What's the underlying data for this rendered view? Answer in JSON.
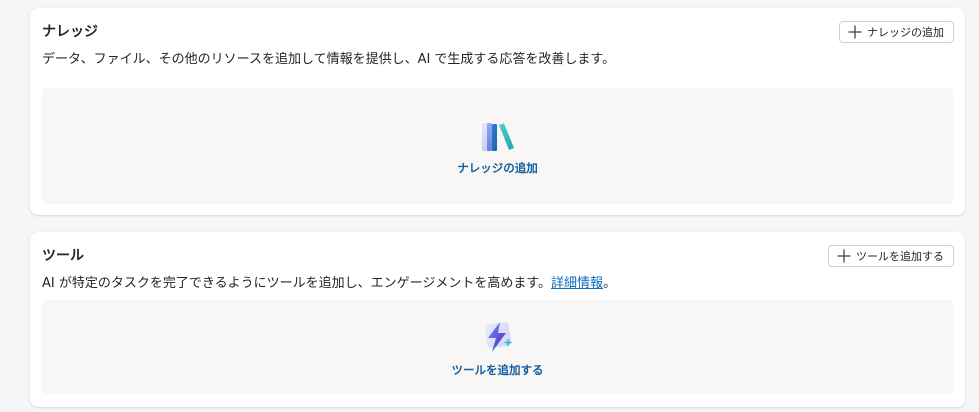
{
  "knowledge": {
    "title": "ナレッジ",
    "description": "データ、ファイル、その他のリソースを追加して情報を提供し、AI で生成する応答を改善します。",
    "add_button_label": "ナレッジの追加",
    "empty_link_label": "ナレッジの追加",
    "illustration_icon": "books-icon"
  },
  "tools": {
    "title": "ツール",
    "description_prefix": "AI が特定のタスクを完了できるようにツールを追加し、エンゲージメントを高めます。",
    "learn_more_link": "詳細情報",
    "description_suffix": "。",
    "add_button_label": "ツールを追加する",
    "empty_link_label": "ツールを追加する",
    "illustration_icon": "lightning-bolt-icon"
  },
  "colors": {
    "page_background": "#f5f6f8",
    "card_background": "#ffffff",
    "empty_area_background": "#f8f7f5",
    "link": "#0f6cbd",
    "empty_link": "#115ea3"
  }
}
